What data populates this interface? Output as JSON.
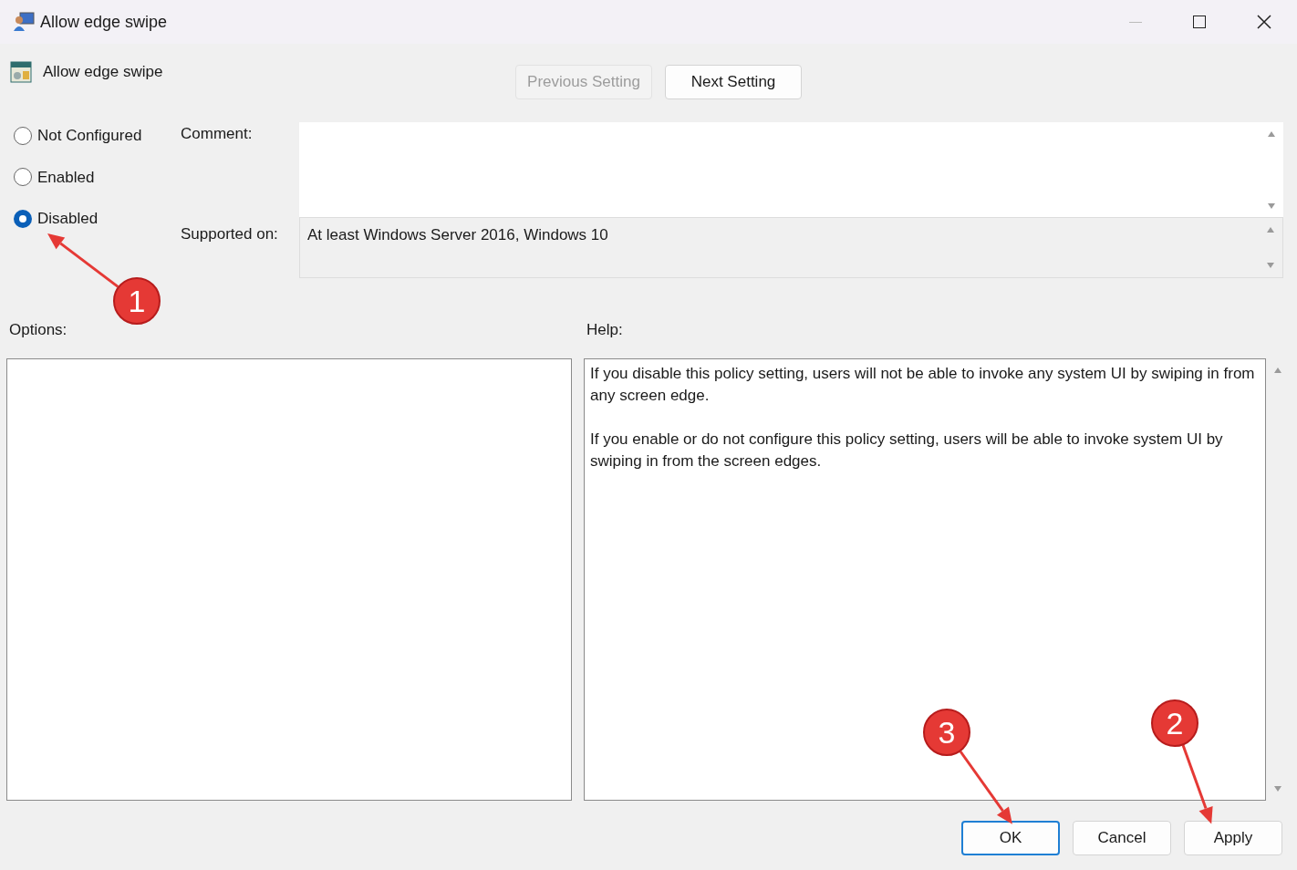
{
  "window": {
    "title": "Allow edge swipe"
  },
  "policy": {
    "name": "Allow edge swipe"
  },
  "nav_buttons": [
    {
      "label": "Previous Setting",
      "disabled": true
    },
    {
      "label": "Next Setting",
      "disabled": false
    }
  ],
  "state_options": [
    {
      "label": "Not Configured",
      "selected": false
    },
    {
      "label": "Enabled",
      "selected": false
    },
    {
      "label": "Disabled",
      "selected": true
    }
  ],
  "comment": {
    "label": "Comment:"
  },
  "supported_on": {
    "label": "Supported on:",
    "value": "At least Windows Server 2016, Windows 10"
  },
  "options": {
    "label": "Options:"
  },
  "help": {
    "label": "Help:",
    "paragraphs": [
      "If you disable this policy setting, users will not be able to invoke any system UI by swiping in from any screen edge.",
      "If you enable or do not configure this policy setting, users will be able to invoke system UI by swiping in from the screen edges."
    ]
  },
  "footer_buttons": [
    {
      "label": "OK",
      "default": true
    },
    {
      "label": "Cancel",
      "default": false
    },
    {
      "label": "Apply",
      "default": false
    }
  ],
  "annotations": [
    {
      "number": "1"
    },
    {
      "number": "2"
    },
    {
      "number": "3"
    }
  ]
}
